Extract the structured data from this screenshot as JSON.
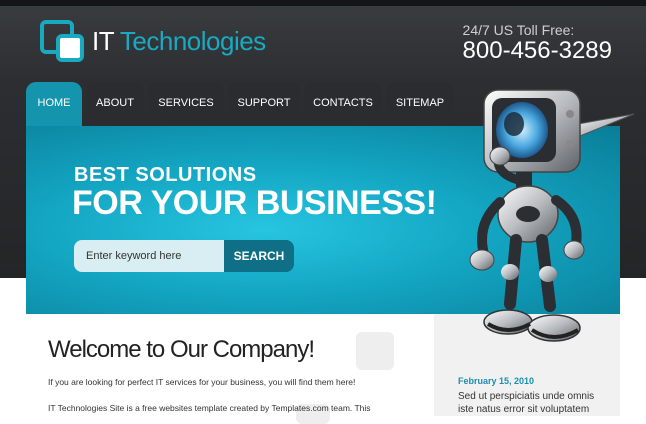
{
  "header": {
    "logo_part1": "IT",
    "logo_part2": "Technologies",
    "phone_label": "24/7 US Toll Free:",
    "phone_number": "800-456-3289"
  },
  "nav": {
    "items": [
      {
        "label": "HOME",
        "active": true
      },
      {
        "label": "ABOUT",
        "active": false
      },
      {
        "label": "SERVICES",
        "active": false
      },
      {
        "label": "SUPPORT",
        "active": false
      },
      {
        "label": "CONTACTS",
        "active": false
      },
      {
        "label": "SITEMAP",
        "active": false
      }
    ]
  },
  "hero": {
    "line1": "BEST SOLUTIONS",
    "line2": "FOR YOUR BUSINESS!"
  },
  "search": {
    "placeholder": "Enter keyword here",
    "button_label": "SEARCH"
  },
  "content": {
    "title": "Welcome to Our Company!",
    "p1": "If you are looking for perfect IT services for your business, you will find them here!",
    "p2": "IT Technologies Site is a free websites template created by Templates.com team. This"
  },
  "sidebar": {
    "news_date": "February 15, 2010",
    "news_text": "Sed ut perspiciatis unde omnis iste natus error sit voluptatem"
  },
  "colors": {
    "accent": "#19a9c0",
    "nav_active": "#1595ad",
    "header_bg": "#2c2e31",
    "search_button": "#0f6f86"
  },
  "icons": [
    "logo-mark-icon",
    "robot-illustration"
  ]
}
